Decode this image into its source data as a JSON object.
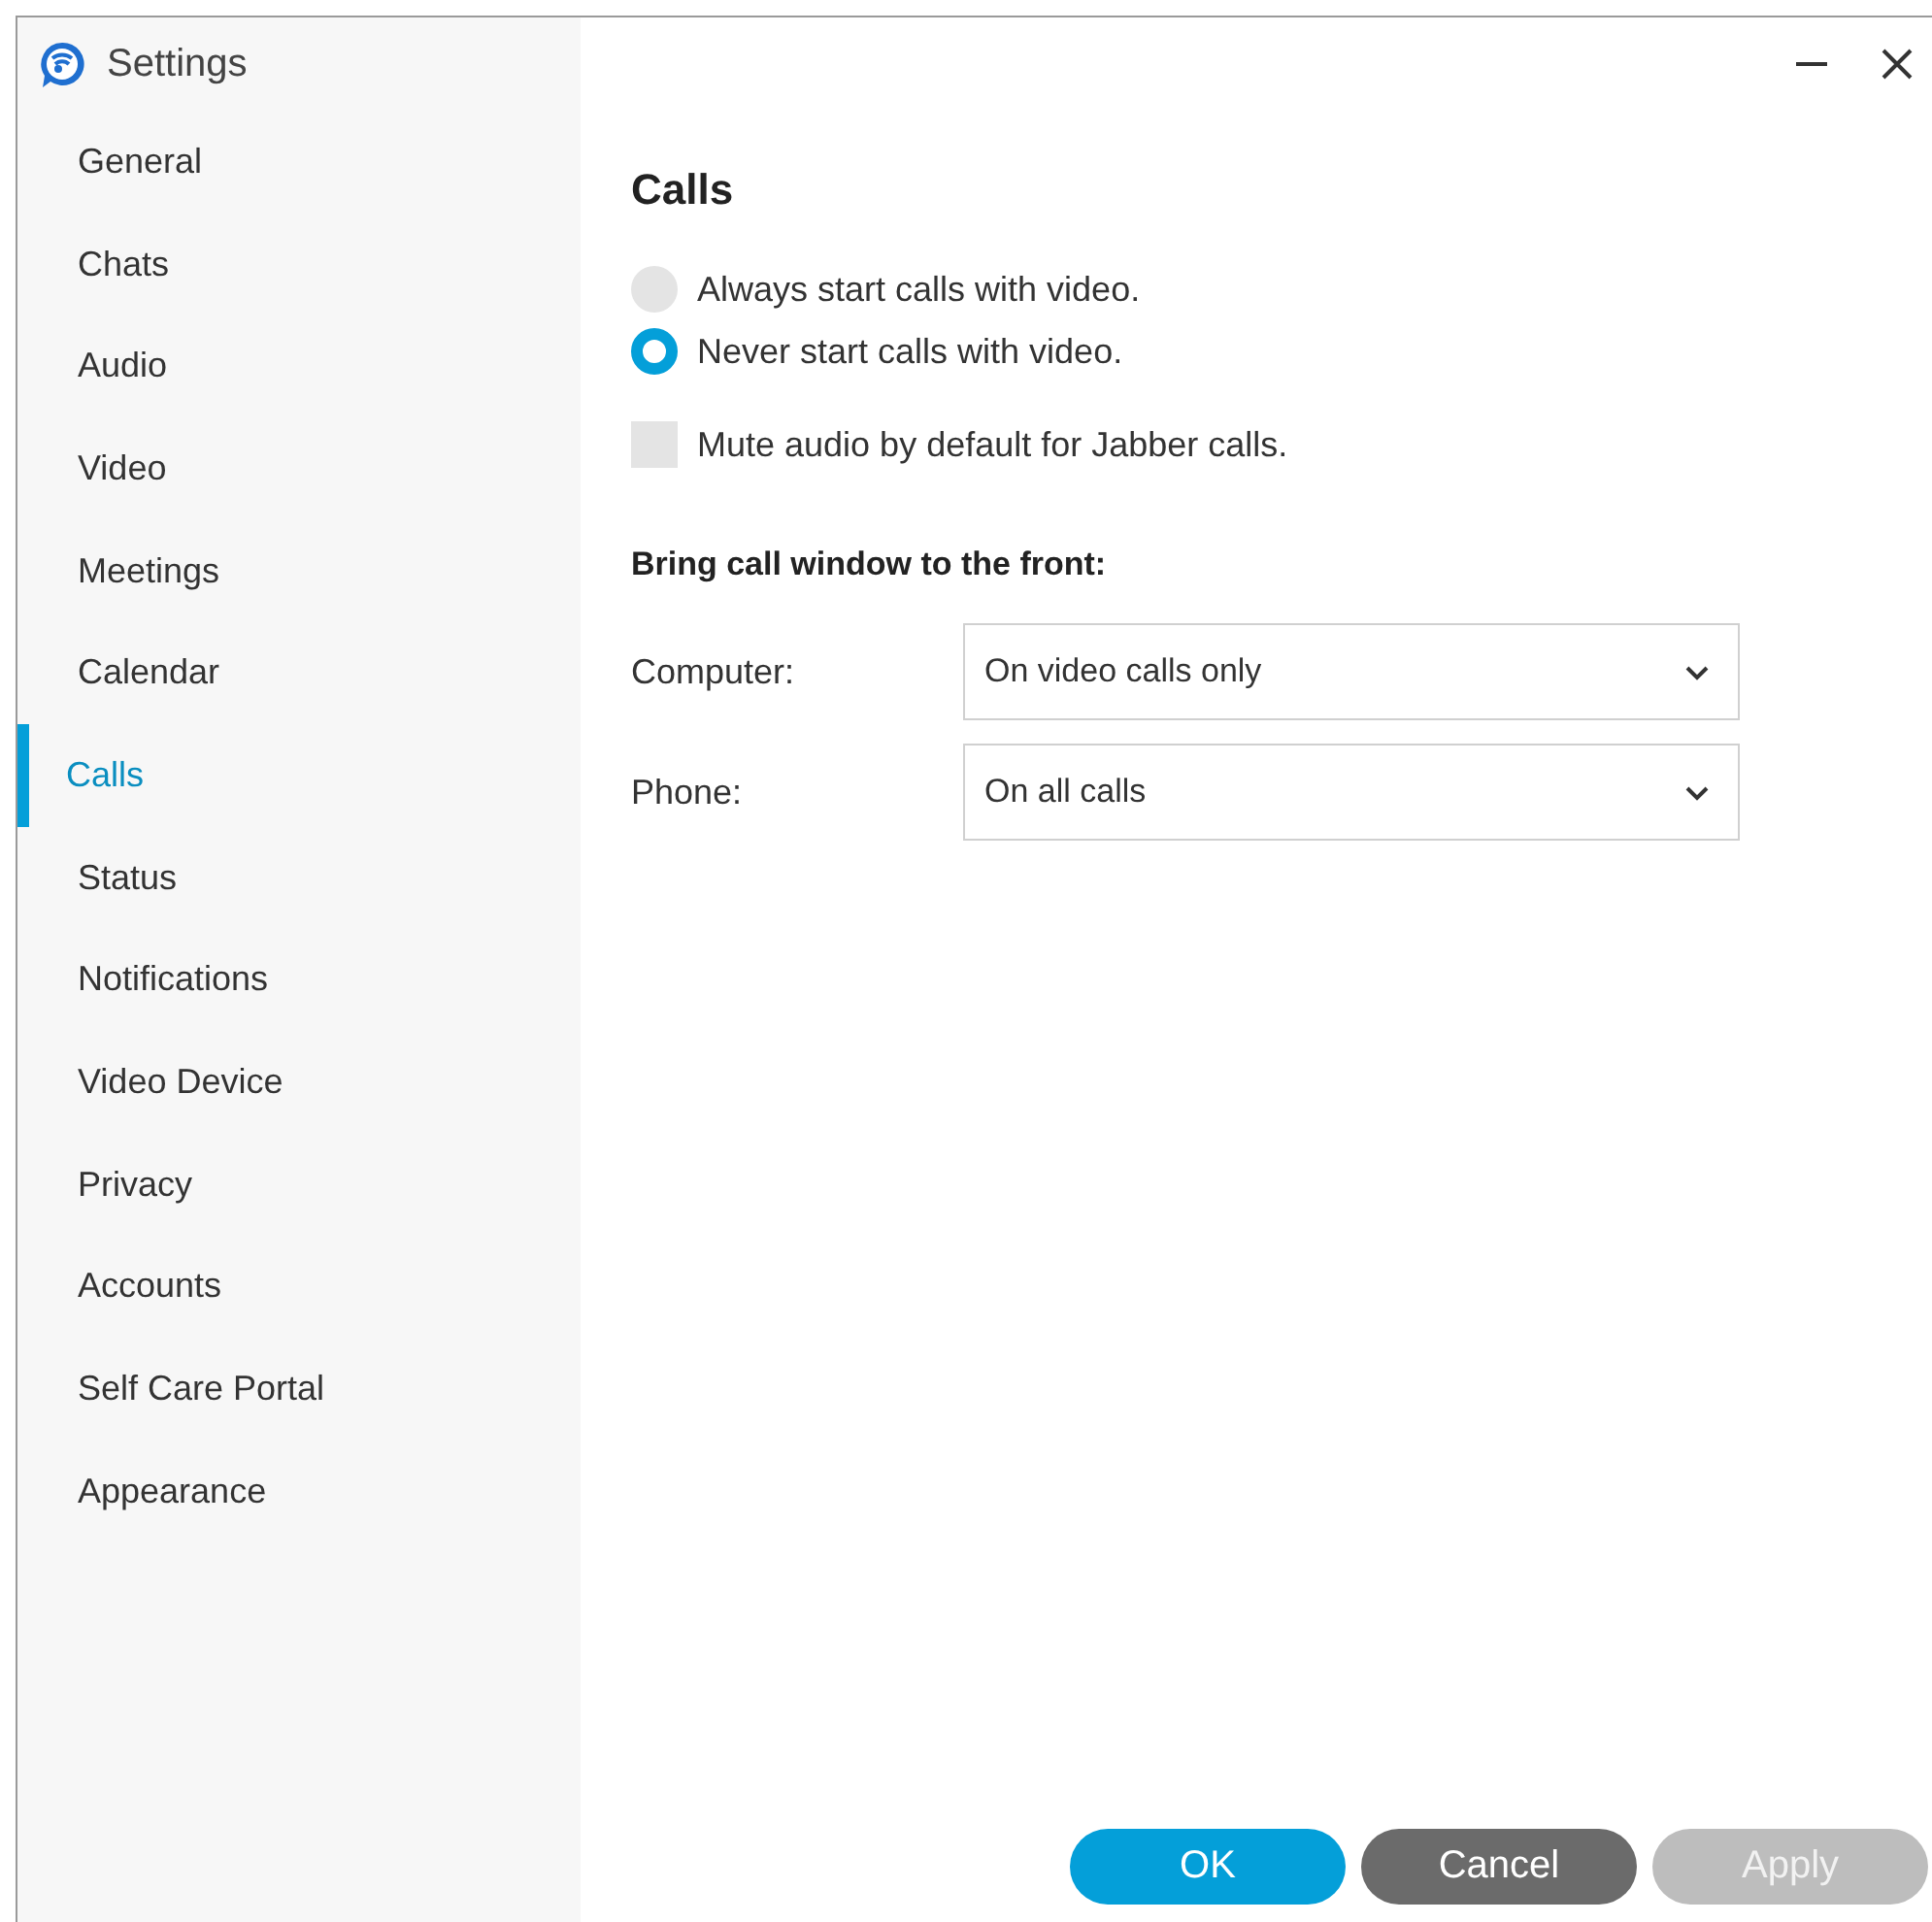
{
  "window": {
    "title": "Settings"
  },
  "sidebar": {
    "items": [
      {
        "label": "General",
        "selected": false
      },
      {
        "label": "Chats",
        "selected": false
      },
      {
        "label": "Audio",
        "selected": false
      },
      {
        "label": "Video",
        "selected": false
      },
      {
        "label": "Meetings",
        "selected": false
      },
      {
        "label": "Calendar",
        "selected": false
      },
      {
        "label": "Calls",
        "selected": true
      },
      {
        "label": "Status",
        "selected": false
      },
      {
        "label": "Notifications",
        "selected": false
      },
      {
        "label": "Video Device",
        "selected": false
      },
      {
        "label": "Privacy",
        "selected": false
      },
      {
        "label": "Accounts",
        "selected": false
      },
      {
        "label": "Self Care Portal",
        "selected": false
      },
      {
        "label": "Appearance",
        "selected": false
      }
    ]
  },
  "section": {
    "title": "Calls",
    "video_options": [
      {
        "label": "Always start calls with video.",
        "selected": false
      },
      {
        "label": "Never start calls with video.",
        "selected": true
      }
    ],
    "mute_option": {
      "label": "Mute audio by default for Jabber calls.",
      "checked": false
    },
    "bring_to_front": {
      "heading": "Bring call window to the front:",
      "rows": [
        {
          "label": "Computer:",
          "value": "On video calls only"
        },
        {
          "label": "Phone:",
          "value": "On all calls"
        }
      ]
    }
  },
  "buttons": [
    {
      "label": "OK",
      "kind": "primary",
      "disabled": false
    },
    {
      "label": "Cancel",
      "kind": "secondary",
      "disabled": false
    },
    {
      "label": "Apply",
      "kind": "secondary",
      "disabled": true
    }
  ]
}
